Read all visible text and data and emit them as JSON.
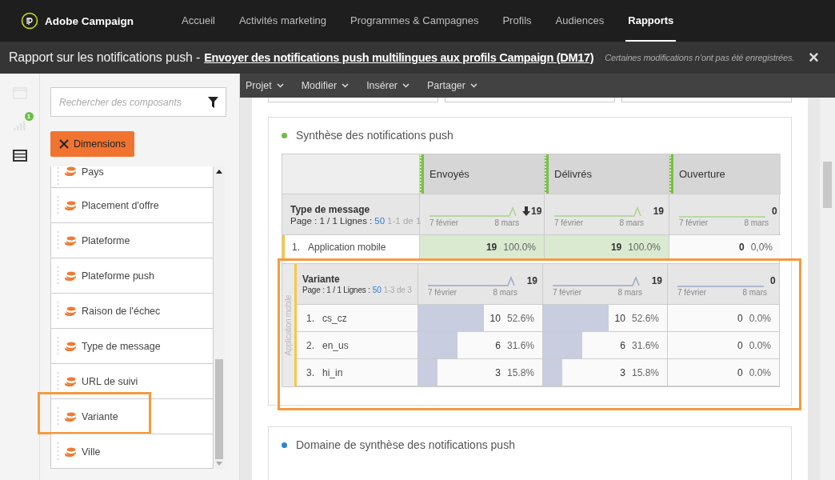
{
  "topnav": {
    "logo": "Adobe Campaign",
    "items": [
      {
        "label": "Accueil",
        "selected": false
      },
      {
        "label": "Activités marketing",
        "selected": false
      },
      {
        "label": "Programmes & Campagnes",
        "selected": false
      },
      {
        "label": "Profils",
        "selected": false
      },
      {
        "label": "Audiences",
        "selected": false
      },
      {
        "label": "Rapports",
        "selected": true
      }
    ]
  },
  "titlebar": {
    "prefix": "Rapport sur les notifications push -",
    "link": "Envoyer des notifications push multilingues aux profils Campaign (DM17)",
    "notice": "Certaines modifications n’ont pas été enregistrées.",
    "close": "×"
  },
  "rail": [
    {
      "kind": "window",
      "selected": false
    },
    {
      "kind": "signal",
      "selected": false,
      "badge": "1"
    },
    {
      "kind": "table",
      "selected": true
    }
  ],
  "panel": {
    "search": {
      "placeholder": "Rechercher des composants"
    },
    "chip": "Dimensions",
    "items": [
      {
        "label": "Pays",
        "highlighted": false
      },
      {
        "label": "Placement d'offre",
        "highlighted": false
      },
      {
        "label": "Plateforme",
        "highlighted": false
      },
      {
        "label": "Plateforme push",
        "highlighted": false
      },
      {
        "label": "Raison de l'échec",
        "highlighted": false
      },
      {
        "label": "Type de message",
        "highlighted": false
      },
      {
        "label": "URL de suivi",
        "highlighted": false
      },
      {
        "label": "Variante",
        "highlighted": true
      },
      {
        "label": "Ville",
        "highlighted": false
      }
    ]
  },
  "toolbar": [
    "Projet",
    "Modifier",
    "Insérer",
    "Partager"
  ],
  "cards": [
    {
      "title": "Synthèse des notifications push",
      "color": "#6cbe45",
      "table": {
        "columns": [
          "Envoyés",
          "Délivrés",
          "Ouverture"
        ],
        "summary": {
          "dimension": "Type de message",
          "page": "Page : 1 / 1 Lignes :",
          "lines": "50",
          "range": "1-1 de 1",
          "totals": [
            {
              "value": "19",
              "sorted": true,
              "spike": true,
              "start": "7 février",
              "end": "8 mars"
            },
            {
              "value": "19",
              "sorted": false,
              "spike": true,
              "start": "7 février",
              "end": "8 mars"
            },
            {
              "value": "0",
              "sorted": false,
              "spike": false,
              "start": "7 février",
              "end": "8 mars"
            }
          ]
        },
        "rows": [
          {
            "index": "1.",
            "label": "Application mobile",
            "cells": [
              {
                "value": "19",
                "pct": "100.0%",
                "level": 1
              },
              {
                "value": "19",
                "pct": "100.0%",
                "level": 1
              },
              {
                "value": "0",
                "pct": "0,0%",
                "level": 0
              }
            ]
          }
        ],
        "breakdown": {
          "side_label": "Application mobile",
          "highlighted": true,
          "summary": {
            "dimension": "Variante",
            "page": "Page : 1 / 1 Lignes :",
            "lines": "50",
            "range": "1-3 de 3",
            "totals": [
              {
                "value": "19",
                "sorted": false,
                "spike": true,
                "start": "7 février",
                "end": "8 mars"
              },
              {
                "value": "19",
                "sorted": false,
                "spike": true,
                "start": "7 février",
                "end": "8 mars"
              },
              {
                "value": "0",
                "sorted": false,
                "spike": false,
                "start": "7 février",
                "end": "8 mars"
              }
            ]
          },
          "rows": [
            {
              "index": "1.",
              "label": "cs_cz",
              "cells": [
                {
                  "value": "10",
                  "pct": "52.6%",
                  "level": 0.526
                },
                {
                  "value": "10",
                  "pct": "52.6%",
                  "level": 0.526
                },
                {
                  "value": "0",
                  "pct": "0.0%",
                  "level": 0
                }
              ]
            },
            {
              "index": "2.",
              "label": "en_us",
              "cells": [
                {
                  "value": "6",
                  "pct": "31.6%",
                  "level": 0.316
                },
                {
                  "value": "6",
                  "pct": "31.6%",
                  "level": 0.316
                },
                {
                  "value": "0",
                  "pct": "0.0%",
                  "level": 0
                }
              ]
            },
            {
              "index": "3.",
              "label": "hi_in",
              "cells": [
                {
                  "value": "3",
                  "pct": "15.8%",
                  "level": 0.158
                },
                {
                  "value": "3",
                  "pct": "15.8%",
                  "level": 0.158
                },
                {
                  "value": "0",
                  "pct": "0.0%",
                  "level": 0
                }
              ]
            }
          ]
        }
      }
    },
    {
      "title": "Domaine de synthèse des notifications push",
      "color": "#2c84d8"
    }
  ]
}
